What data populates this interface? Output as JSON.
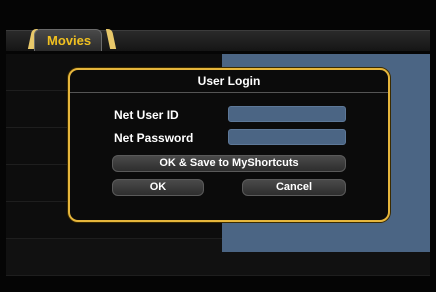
{
  "header": {
    "tab_label": "Movies"
  },
  "dialog": {
    "title": "User Login",
    "user_id_label": "Net User ID",
    "password_label": "Net Password",
    "user_id_value": "",
    "password_value": "",
    "save_button_label": "OK & Save to MyShortcuts",
    "ok_button_label": "OK",
    "cancel_button_label": "Cancel"
  },
  "colors": {
    "accent": "#e6b63c",
    "field_blue": "#4b6584",
    "tab_text": "#f0c020"
  }
}
